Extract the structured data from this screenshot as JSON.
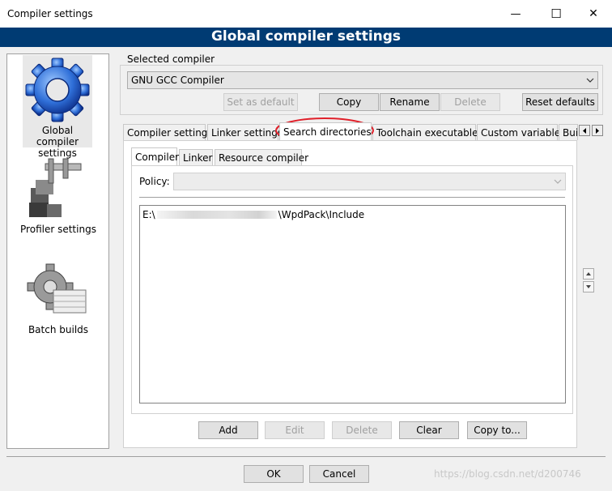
{
  "window": {
    "title": "Compiler settings",
    "minimize_glyph": "—",
    "maximize_glyph": "☐",
    "close_glyph": "✕"
  },
  "banner": {
    "title": "Global compiler settings",
    "color": "#003b73"
  },
  "sidebar": {
    "items": [
      {
        "label": "Global compiler settings",
        "icon": "gear-icon"
      },
      {
        "label": "Profiler settings",
        "icon": "caliper-icon"
      },
      {
        "label": "Batch builds",
        "icon": "batch-gear-icon"
      }
    ]
  },
  "selected_compiler": {
    "group_label": "Selected compiler",
    "value": "GNU GCC Compiler"
  },
  "compiler_buttons": {
    "set_default": "Set as default",
    "copy": "Copy",
    "rename": "Rename",
    "delete": "Delete",
    "reset": "Reset defaults"
  },
  "main_tabs": [
    "Compiler settings",
    "Linker settings",
    "Search directories",
    "Toolchain executables",
    "Custom variables",
    "Bui"
  ],
  "sub_tabs": [
    "Compiler",
    "Linker",
    "Resource compiler"
  ],
  "policy": {
    "label": "Policy:",
    "value": ""
  },
  "directories": {
    "prefix": "E:\\",
    "suffix": "\\WpdPack\\Include"
  },
  "list_buttons": {
    "add": "Add",
    "edit": "Edit",
    "delete": "Delete",
    "clear": "Clear",
    "copy_to": "Copy to..."
  },
  "footer": {
    "ok": "OK",
    "cancel": "Cancel",
    "watermark": "https://blog.csdn.net/d200746"
  },
  "colors": {
    "highlight_circle": "#e0202a",
    "banner": "#003b73"
  }
}
